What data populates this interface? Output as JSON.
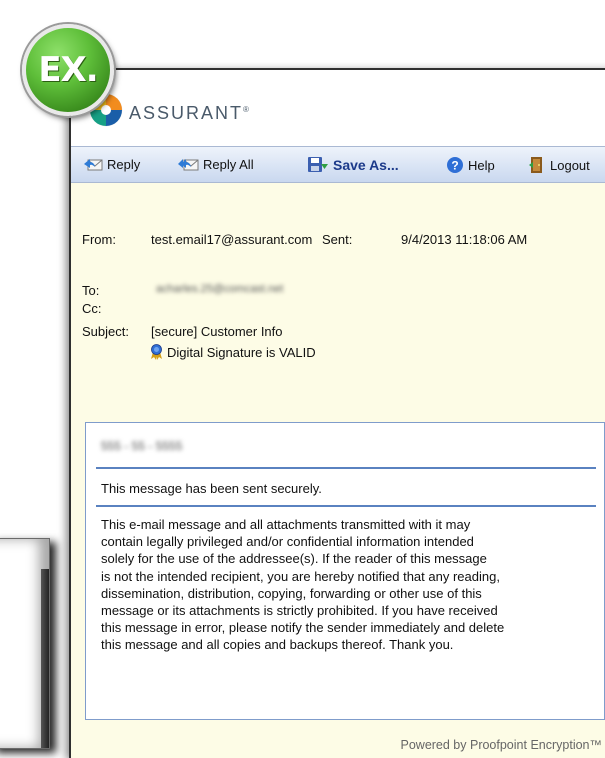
{
  "badge": {
    "label": "EX."
  },
  "brand": {
    "name": "ASSURANT",
    "mark": "®"
  },
  "toolbar": {
    "reply": "Reply",
    "reply_all": "Reply All",
    "save_as": "Save As...",
    "help": "Help",
    "logout": "Logout"
  },
  "header": {
    "from_label": "From:",
    "from_value": "test.email17@assurant.com",
    "sent_label": "Sent:",
    "sent_value": "9/4/2013 11:18:06 AM",
    "to_label": "To:",
    "to_value": "acharles.25@comcast.net",
    "cc_label": "Cc:",
    "subject_label": "Subject:",
    "subject_value": "[secure] Customer Info",
    "signature": "Digital Signature is VALID"
  },
  "message": {
    "redacted_ssn": "555 - 55 - 5555",
    "secure_note": "This message has been sent securely.",
    "disclaimer_lines": [
      "This e-mail message and all attachments transmitted with it may",
      "contain legally privileged and/or confidential information intended",
      "solely for the use of the addressee(s). If the reader of this message",
      "is not the intended recipient, you are hereby notified that any reading,",
      "dissemination, distribution, copying, forwarding or other use of this",
      "message or its attachments is strictly prohibited. If you have received",
      "this message in error, please notify the sender immediately and delete",
      "this message and all copies and backups thereof. Thank you."
    ]
  },
  "footer": {
    "powered_by": "Powered by Proofpoint Encryption™"
  }
}
